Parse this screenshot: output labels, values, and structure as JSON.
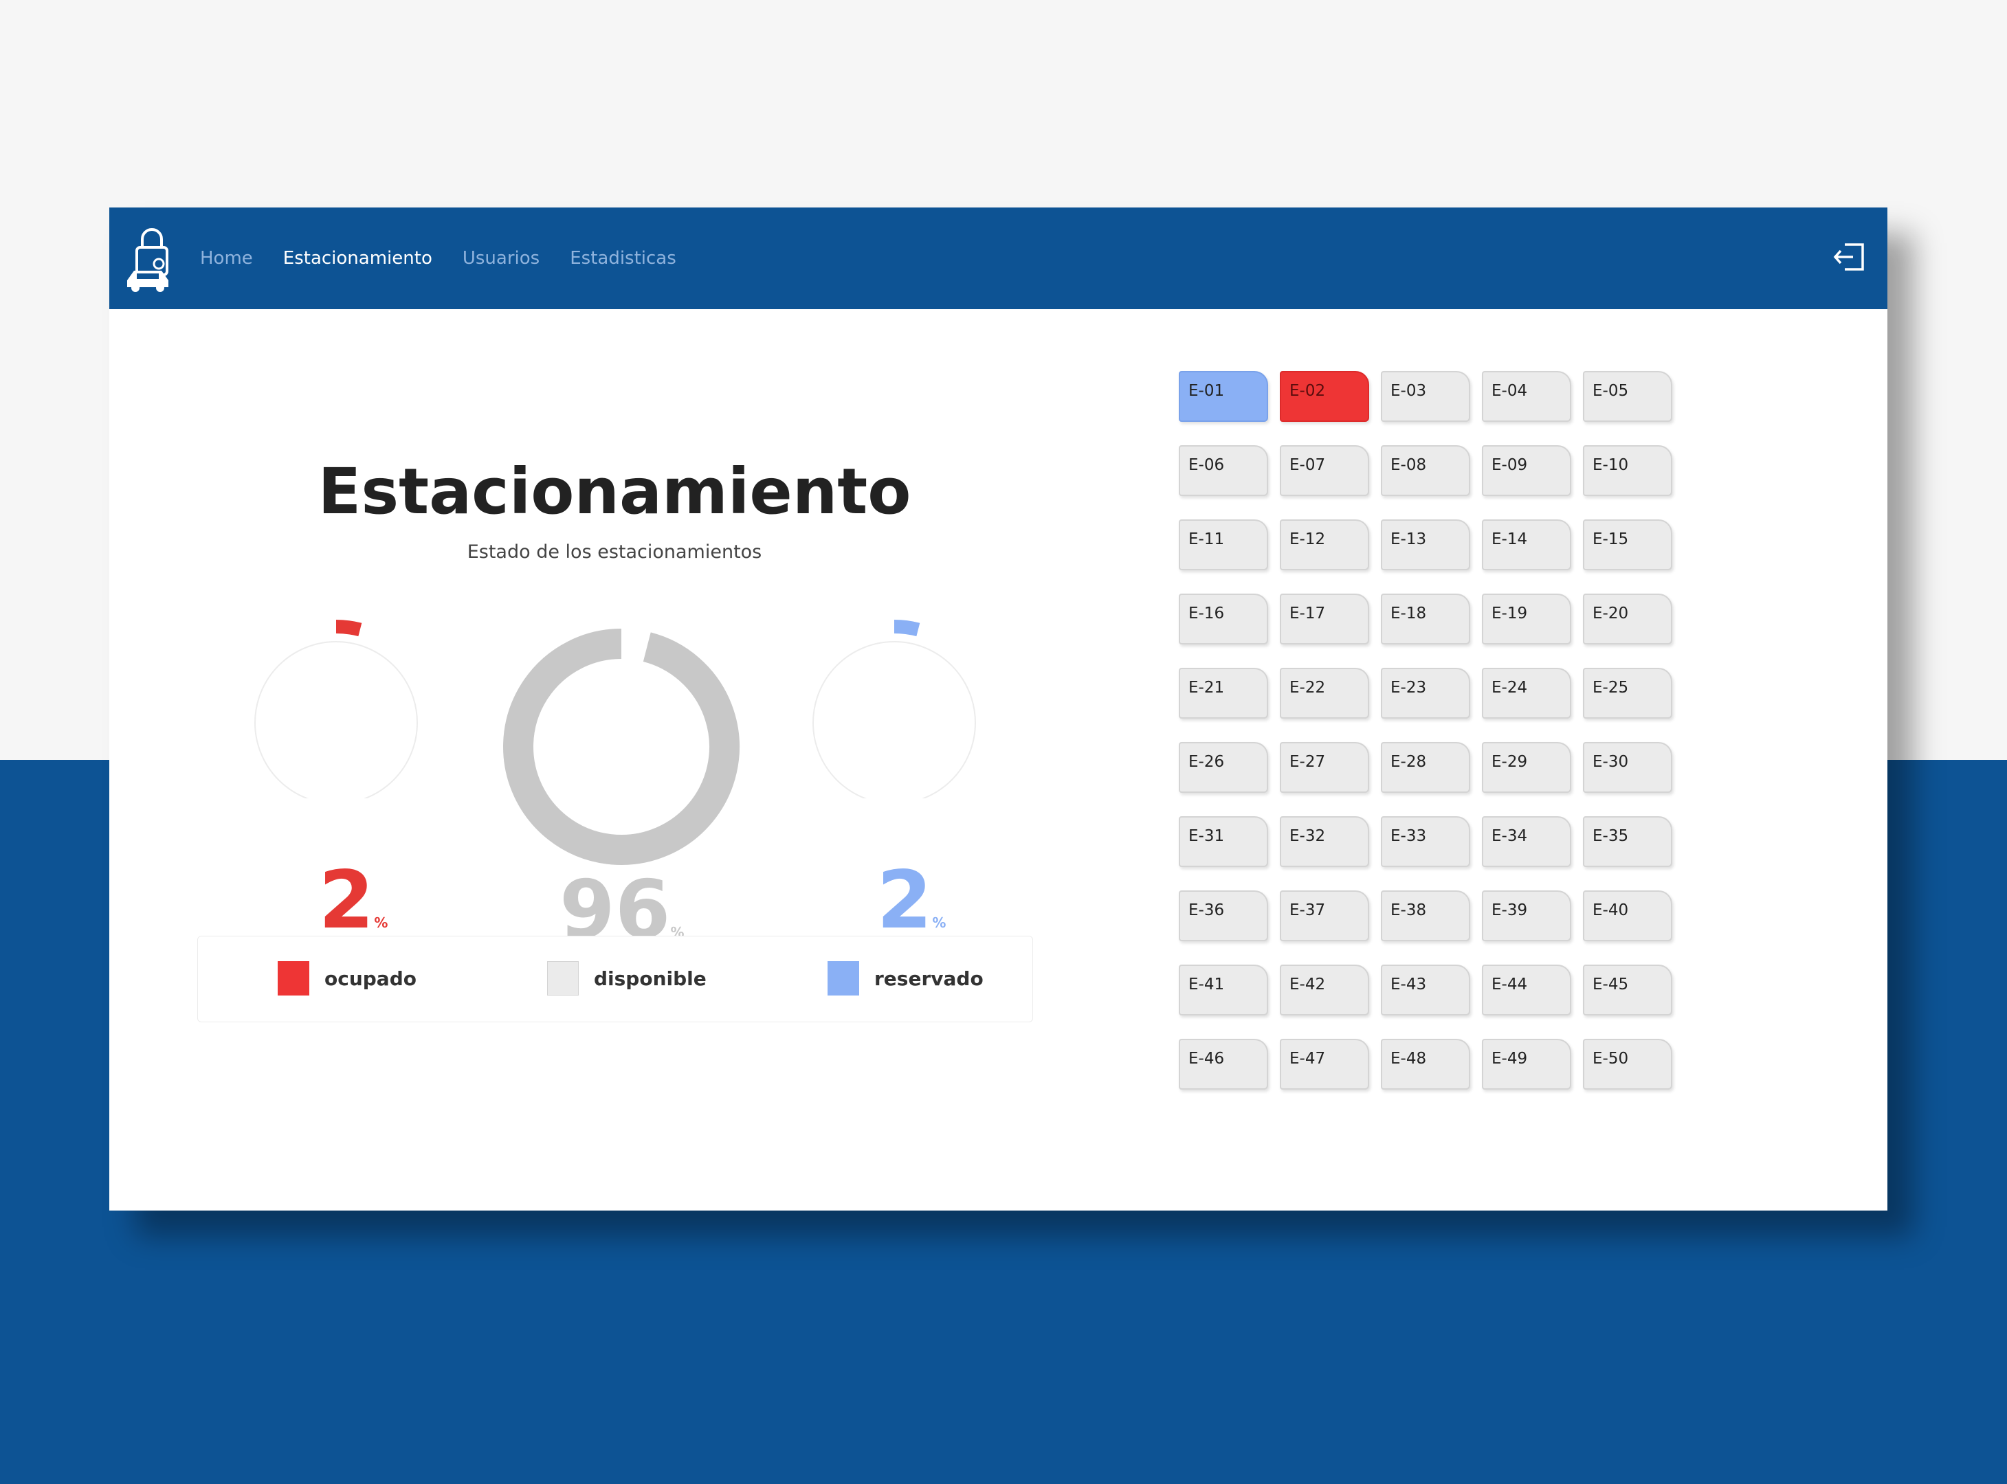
{
  "nav": {
    "links": [
      "Home",
      "Estacionamiento",
      "Usuarios",
      "Estadisticas"
    ],
    "active": "Estacionamiento",
    "logo_icon": "lock-car-icon",
    "logout_icon": "logout-icon"
  },
  "page": {
    "title": "Estacionamiento",
    "subtitle": "Estado de los estacionamientos"
  },
  "stats": {
    "ocupado": {
      "value": "2",
      "unit": "%",
      "fraction": 0.02,
      "color": "#e53935"
    },
    "disponible": {
      "value": "96",
      "unit": "%",
      "fraction": 0.96,
      "color": "#c8c8c8"
    },
    "reservado": {
      "value": "2",
      "unit": "%",
      "fraction": 0.02,
      "color": "#8ab0f5"
    }
  },
  "legend": {
    "ocupado": "ocupado",
    "disponible": "disponible",
    "reservado": "reservado",
    "colors": {
      "ocupado": "#ee3535",
      "disponible": "#ebebeb",
      "reservado": "#8ab0f5"
    }
  },
  "slots": [
    {
      "label": "E-01",
      "status": "reservado"
    },
    {
      "label": "E-02",
      "status": "ocupado"
    },
    {
      "label": "E-03",
      "status": "disponible"
    },
    {
      "label": "E-04",
      "status": "disponible"
    },
    {
      "label": "E-05",
      "status": "disponible"
    },
    {
      "label": "E-06",
      "status": "disponible"
    },
    {
      "label": "E-07",
      "status": "disponible"
    },
    {
      "label": "E-08",
      "status": "disponible"
    },
    {
      "label": "E-09",
      "status": "disponible"
    },
    {
      "label": "E-10",
      "status": "disponible"
    },
    {
      "label": "E-11",
      "status": "disponible"
    },
    {
      "label": "E-12",
      "status": "disponible"
    },
    {
      "label": "E-13",
      "status": "disponible"
    },
    {
      "label": "E-14",
      "status": "disponible"
    },
    {
      "label": "E-15",
      "status": "disponible"
    },
    {
      "label": "E-16",
      "status": "disponible"
    },
    {
      "label": "E-17",
      "status": "disponible"
    },
    {
      "label": "E-18",
      "status": "disponible"
    },
    {
      "label": "E-19",
      "status": "disponible"
    },
    {
      "label": "E-20",
      "status": "disponible"
    },
    {
      "label": "E-21",
      "status": "disponible"
    },
    {
      "label": "E-22",
      "status": "disponible"
    },
    {
      "label": "E-23",
      "status": "disponible"
    },
    {
      "label": "E-24",
      "status": "disponible"
    },
    {
      "label": "E-25",
      "status": "disponible"
    },
    {
      "label": "E-26",
      "status": "disponible"
    },
    {
      "label": "E-27",
      "status": "disponible"
    },
    {
      "label": "E-28",
      "status": "disponible"
    },
    {
      "label": "E-29",
      "status": "disponible"
    },
    {
      "label": "E-30",
      "status": "disponible"
    },
    {
      "label": "E-31",
      "status": "disponible"
    },
    {
      "label": "E-32",
      "status": "disponible"
    },
    {
      "label": "E-33",
      "status": "disponible"
    },
    {
      "label": "E-34",
      "status": "disponible"
    },
    {
      "label": "E-35",
      "status": "disponible"
    },
    {
      "label": "E-36",
      "status": "disponible"
    },
    {
      "label": "E-37",
      "status": "disponible"
    },
    {
      "label": "E-38",
      "status": "disponible"
    },
    {
      "label": "E-39",
      "status": "disponible"
    },
    {
      "label": "E-40",
      "status": "disponible"
    },
    {
      "label": "E-41",
      "status": "disponible"
    },
    {
      "label": "E-42",
      "status": "disponible"
    },
    {
      "label": "E-43",
      "status": "disponible"
    },
    {
      "label": "E-44",
      "status": "disponible"
    },
    {
      "label": "E-45",
      "status": "disponible"
    },
    {
      "label": "E-46",
      "status": "disponible"
    },
    {
      "label": "E-47",
      "status": "disponible"
    },
    {
      "label": "E-48",
      "status": "disponible"
    },
    {
      "label": "E-49",
      "status": "disponible"
    },
    {
      "label": "E-50",
      "status": "disponible"
    }
  ]
}
